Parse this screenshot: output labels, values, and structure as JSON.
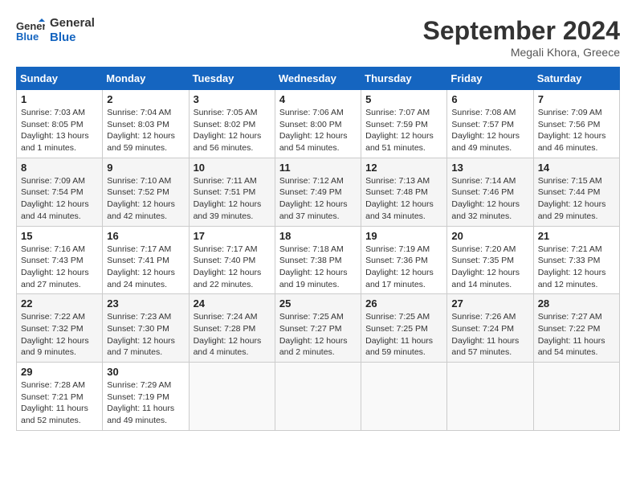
{
  "header": {
    "logo_line1": "General",
    "logo_line2": "Blue",
    "month_title": "September 2024",
    "location": "Megali Khora, Greece"
  },
  "weekdays": [
    "Sunday",
    "Monday",
    "Tuesday",
    "Wednesday",
    "Thursday",
    "Friday",
    "Saturday"
  ],
  "weeks": [
    [
      {
        "day": "1",
        "sunrise": "7:03 AM",
        "sunset": "8:05 PM",
        "daylight": "13 hours and 1 minute."
      },
      {
        "day": "2",
        "sunrise": "7:04 AM",
        "sunset": "8:03 PM",
        "daylight": "12 hours and 59 minutes."
      },
      {
        "day": "3",
        "sunrise": "7:05 AM",
        "sunset": "8:02 PM",
        "daylight": "12 hours and 56 minutes."
      },
      {
        "day": "4",
        "sunrise": "7:06 AM",
        "sunset": "8:00 PM",
        "daylight": "12 hours and 54 minutes."
      },
      {
        "day": "5",
        "sunrise": "7:07 AM",
        "sunset": "7:59 PM",
        "daylight": "12 hours and 51 minutes."
      },
      {
        "day": "6",
        "sunrise": "7:08 AM",
        "sunset": "7:57 PM",
        "daylight": "12 hours and 49 minutes."
      },
      {
        "day": "7",
        "sunrise": "7:09 AM",
        "sunset": "7:56 PM",
        "daylight": "12 hours and 46 minutes."
      }
    ],
    [
      {
        "day": "8",
        "sunrise": "7:09 AM",
        "sunset": "7:54 PM",
        "daylight": "12 hours and 44 minutes."
      },
      {
        "day": "9",
        "sunrise": "7:10 AM",
        "sunset": "7:52 PM",
        "daylight": "12 hours and 42 minutes."
      },
      {
        "day": "10",
        "sunrise": "7:11 AM",
        "sunset": "7:51 PM",
        "daylight": "12 hours and 39 minutes."
      },
      {
        "day": "11",
        "sunrise": "7:12 AM",
        "sunset": "7:49 PM",
        "daylight": "12 hours and 37 minutes."
      },
      {
        "day": "12",
        "sunrise": "7:13 AM",
        "sunset": "7:48 PM",
        "daylight": "12 hours and 34 minutes."
      },
      {
        "day": "13",
        "sunrise": "7:14 AM",
        "sunset": "7:46 PM",
        "daylight": "12 hours and 32 minutes."
      },
      {
        "day": "14",
        "sunrise": "7:15 AM",
        "sunset": "7:44 PM",
        "daylight": "12 hours and 29 minutes."
      }
    ],
    [
      {
        "day": "15",
        "sunrise": "7:16 AM",
        "sunset": "7:43 PM",
        "daylight": "12 hours and 27 minutes."
      },
      {
        "day": "16",
        "sunrise": "7:17 AM",
        "sunset": "7:41 PM",
        "daylight": "12 hours and 24 minutes."
      },
      {
        "day": "17",
        "sunrise": "7:17 AM",
        "sunset": "7:40 PM",
        "daylight": "12 hours and 22 minutes."
      },
      {
        "day": "18",
        "sunrise": "7:18 AM",
        "sunset": "7:38 PM",
        "daylight": "12 hours and 19 minutes."
      },
      {
        "day": "19",
        "sunrise": "7:19 AM",
        "sunset": "7:36 PM",
        "daylight": "12 hours and 17 minutes."
      },
      {
        "day": "20",
        "sunrise": "7:20 AM",
        "sunset": "7:35 PM",
        "daylight": "12 hours and 14 minutes."
      },
      {
        "day": "21",
        "sunrise": "7:21 AM",
        "sunset": "7:33 PM",
        "daylight": "12 hours and 12 minutes."
      }
    ],
    [
      {
        "day": "22",
        "sunrise": "7:22 AM",
        "sunset": "7:32 PM",
        "daylight": "12 hours and 9 minutes."
      },
      {
        "day": "23",
        "sunrise": "7:23 AM",
        "sunset": "7:30 PM",
        "daylight": "12 hours and 7 minutes."
      },
      {
        "day": "24",
        "sunrise": "7:24 AM",
        "sunset": "7:28 PM",
        "daylight": "12 hours and 4 minutes."
      },
      {
        "day": "25",
        "sunrise": "7:25 AM",
        "sunset": "7:27 PM",
        "daylight": "12 hours and 2 minutes."
      },
      {
        "day": "26",
        "sunrise": "7:25 AM",
        "sunset": "7:25 PM",
        "daylight": "11 hours and 59 minutes."
      },
      {
        "day": "27",
        "sunrise": "7:26 AM",
        "sunset": "7:24 PM",
        "daylight": "11 hours and 57 minutes."
      },
      {
        "day": "28",
        "sunrise": "7:27 AM",
        "sunset": "7:22 PM",
        "daylight": "11 hours and 54 minutes."
      }
    ],
    [
      {
        "day": "29",
        "sunrise": "7:28 AM",
        "sunset": "7:21 PM",
        "daylight": "11 hours and 52 minutes."
      },
      {
        "day": "30",
        "sunrise": "7:29 AM",
        "sunset": "7:19 PM",
        "daylight": "11 hours and 49 minutes."
      },
      null,
      null,
      null,
      null,
      null
    ]
  ]
}
